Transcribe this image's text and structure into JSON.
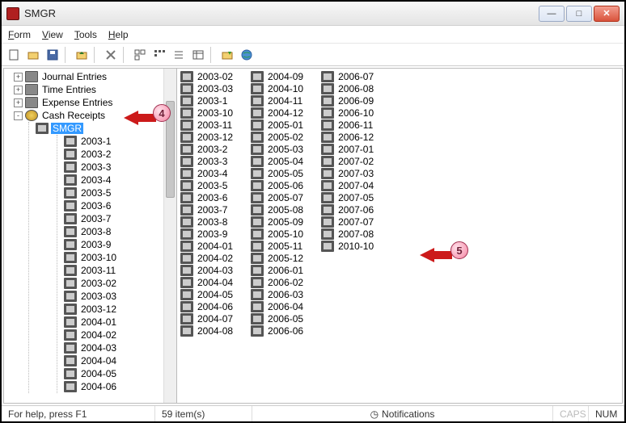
{
  "title": "SMGR",
  "menu": {
    "form": "Form",
    "view": "View",
    "tools": "Tools",
    "help": "Help"
  },
  "toolbar_icons": [
    "new-doc",
    "open-folder",
    "save",
    "|",
    "folder-up",
    "|",
    "delete",
    "|",
    "list-large",
    "list-small",
    "list-details",
    "list-icons",
    "|",
    "folder-open",
    "globe"
  ],
  "tree": {
    "nodes": [
      {
        "id": "journal",
        "label": "Journal Entries",
        "exp": "+"
      },
      {
        "id": "time",
        "label": "Time Entries",
        "exp": "+"
      },
      {
        "id": "expense",
        "label": "Expense Entries",
        "exp": "+"
      },
      {
        "id": "cash",
        "label": "Cash Receipts",
        "exp": "-",
        "children": [
          {
            "id": "smgr",
            "label": "SMGR",
            "selected": true,
            "children": [
              "2003-1",
              "2003-2",
              "2003-3",
              "2003-4",
              "2003-5",
              "2003-6",
              "2003-7",
              "2003-8",
              "2003-9",
              "2003-10",
              "2003-11",
              "2003-02",
              "2003-03",
              "2003-12",
              "2004-01",
              "2004-02",
              "2004-03",
              "2004-04",
              "2004-05",
              "2004-06"
            ]
          }
        ]
      }
    ]
  },
  "list": {
    "col1": [
      "2003-02",
      "2003-03",
      "2003-1",
      "2003-10",
      "2003-11",
      "2003-12",
      "2003-2",
      "2003-3",
      "2003-4",
      "2003-5",
      "2003-6",
      "2003-7",
      "2003-8",
      "2003-9",
      "2004-01",
      "2004-02",
      "2004-03",
      "2004-04",
      "2004-05",
      "2004-06",
      "2004-07",
      "2004-08"
    ],
    "col2": [
      "2004-09",
      "2004-10",
      "2004-11",
      "2004-12",
      "2005-01",
      "2005-02",
      "2005-03",
      "2005-04",
      "2005-05",
      "2005-06",
      "2005-07",
      "2005-08",
      "2005-09",
      "2005-10",
      "2005-11",
      "2005-12",
      "2006-01",
      "2006-02",
      "2006-03",
      "2006-04",
      "2006-05",
      "2006-06"
    ],
    "col3": [
      "2006-07",
      "2006-08",
      "2006-09",
      "2006-10",
      "2006-11",
      "2006-12",
      "2007-01",
      "2007-02",
      "2007-03",
      "2007-04",
      "2007-05",
      "2007-06",
      "2007-07",
      "2007-08",
      "2010-10"
    ]
  },
  "callouts": {
    "c4": "4",
    "c5": "5"
  },
  "status": {
    "help": "For help, press F1",
    "count": "59 item(s)",
    "notif": "Notifications",
    "caps": "CAPS",
    "num": "NUM"
  }
}
